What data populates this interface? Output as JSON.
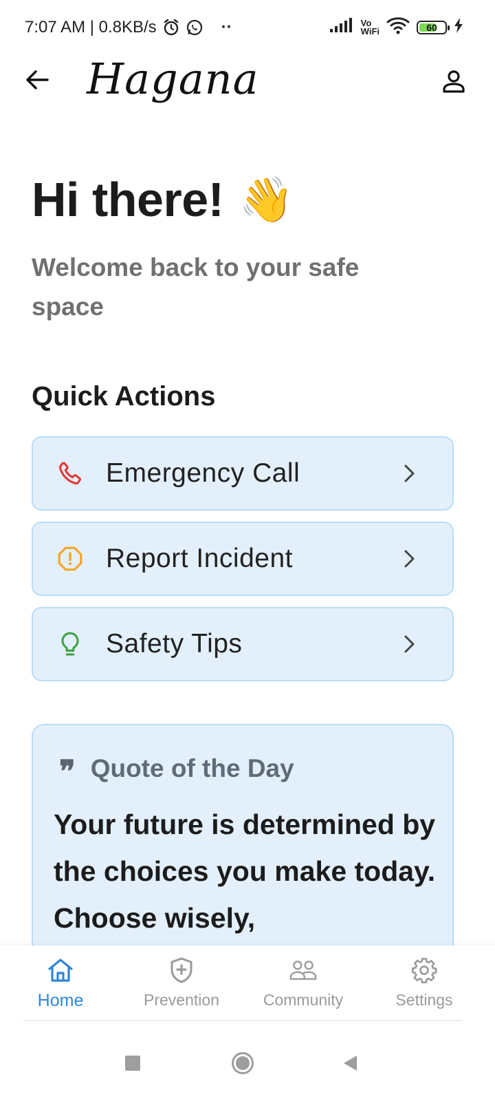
{
  "status_bar": {
    "time_speed": "7:07 AM | 0.8KB/s",
    "more": "··",
    "network_label_top": "Vo",
    "network_label_bottom": "WiFi",
    "battery": "60",
    "battery_level": 0.6,
    "icons": [
      "alarm-icon",
      "whatsapp-icon",
      "signal-icon",
      "wifi-icon",
      "battery-icon",
      "charging-icon"
    ]
  },
  "header": {
    "app_name": "Hagana",
    "icons": [
      "back-arrow-icon",
      "profile-icon"
    ]
  },
  "greeting": {
    "title": "Hi there!",
    "emoji": "👋",
    "subtitle": "Welcome back to your safe space"
  },
  "quick_actions": {
    "title": "Quick Actions",
    "items": [
      {
        "label": "Emergency Call",
        "icon": "phone-icon",
        "color": "#e53935"
      },
      {
        "label": "Report Incident",
        "icon": "alert-octagon-icon",
        "color": "#f5a524"
      },
      {
        "label": "Safety Tips",
        "icon": "lightbulb-icon",
        "color": "#43a047"
      }
    ]
  },
  "quote": {
    "title": "Quote of the Day",
    "icon": "❞",
    "text": "Your future is determined by the choices you make today. Choose wisely,"
  },
  "bottom_nav": {
    "items": [
      {
        "label": "Home",
        "icon": "home-icon",
        "active": true
      },
      {
        "label": "Prevention",
        "icon": "shield-plus-icon",
        "active": false
      },
      {
        "label": "Community",
        "icon": "people-icon",
        "active": false
      },
      {
        "label": "Settings",
        "icon": "gear-icon",
        "active": false
      }
    ]
  },
  "colors": {
    "accent": "#2f86d8",
    "card_bg": "#e3f0fc",
    "card_border": "#b9dbf5",
    "inactive": "#9a9a9a"
  }
}
